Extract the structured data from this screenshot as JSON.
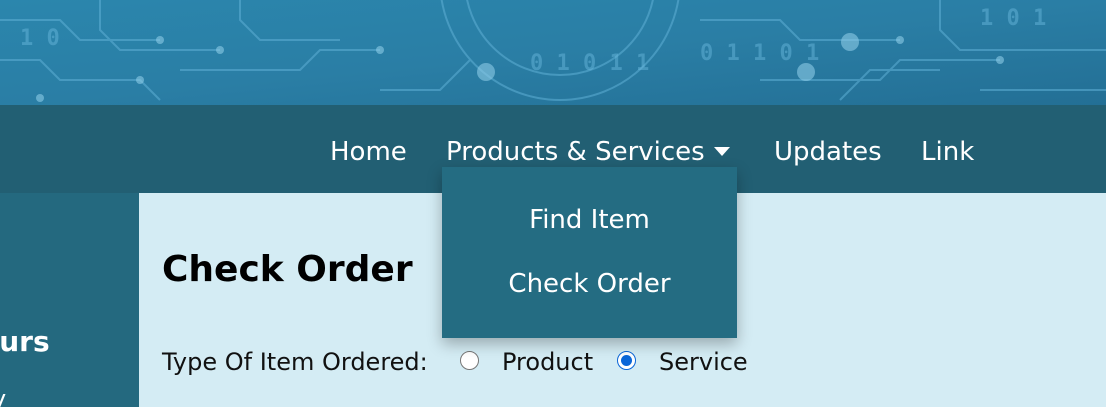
{
  "nav": {
    "items": [
      {
        "label": "Home"
      },
      {
        "label": "Products & Services",
        "icon": "caret-down-icon"
      },
      {
        "label": "Updates"
      },
      {
        "label": "Link"
      }
    ]
  },
  "dropdown": {
    "items": [
      {
        "label": "Find Item"
      },
      {
        "label": "Check Order"
      }
    ]
  },
  "sidebar": {
    "heading": "ours",
    "sub": "y"
  },
  "main": {
    "title": "Check Order",
    "form": {
      "label": "Type Of Item Ordered:",
      "options": [
        {
          "label": "Product",
          "checked": false
        },
        {
          "label": "Service",
          "checked": true
        }
      ]
    }
  },
  "colors": {
    "banner": "#2a7fa6",
    "navbar": "#225f73",
    "sidebar": "#24697f",
    "dropdown": "#246c82",
    "main_bg": "#d4ecf4",
    "radio_accent": "#0a66d8"
  }
}
